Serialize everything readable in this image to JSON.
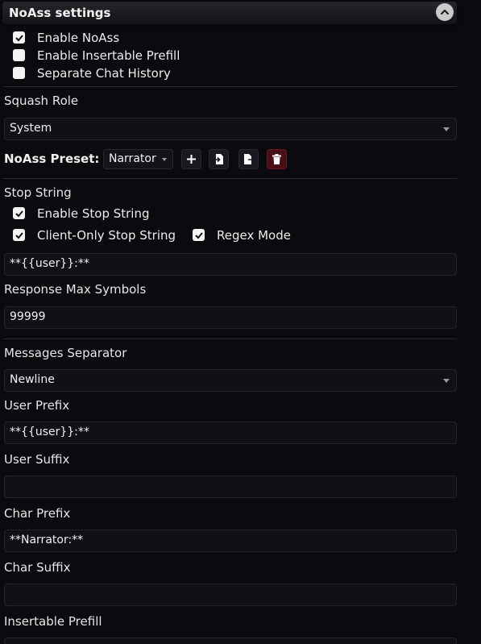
{
  "header": {
    "title": "NoAss settings"
  },
  "checks": {
    "enable_noass": {
      "label": "Enable NoAss",
      "checked": true
    },
    "insertable_prefill": {
      "label": "Enable Insertable Prefill",
      "checked": false
    },
    "separate_history": {
      "label": "Separate Chat History",
      "checked": false
    }
  },
  "squash_role": {
    "label": "Squash Role",
    "value": "System"
  },
  "preset": {
    "label": "NoAss Preset:",
    "value": "Narrator",
    "buttons": [
      "plus-icon",
      "import-icon",
      "export-icon",
      "trash-icon"
    ]
  },
  "stop_string": {
    "label": "Stop String",
    "enable": {
      "label": "Enable Stop String",
      "checked": true
    },
    "client_only": {
      "label": "Client-Only Stop String",
      "checked": true
    },
    "regex": {
      "label": "Regex Mode",
      "checked": true
    },
    "value": "**{{user}}:**"
  },
  "response_max": {
    "label": "Response Max Symbols",
    "value": "99999"
  },
  "messages_separator": {
    "label": "Messages Separator",
    "value": "Newline"
  },
  "user_prefix": {
    "label": "User Prefix",
    "value": "**{{user}}:**"
  },
  "user_suffix": {
    "label": "User Suffix",
    "value": ""
  },
  "char_prefix": {
    "label": "Char Prefix",
    "value": "**Narrator:**"
  },
  "char_suffix": {
    "label": "Char Suffix",
    "value": ""
  },
  "insertable_prefill_label": "Insertable Prefill",
  "colors": {
    "danger": "#4a0f14",
    "panel_bg": "#0b0a0e",
    "field_bg": "#111015"
  }
}
